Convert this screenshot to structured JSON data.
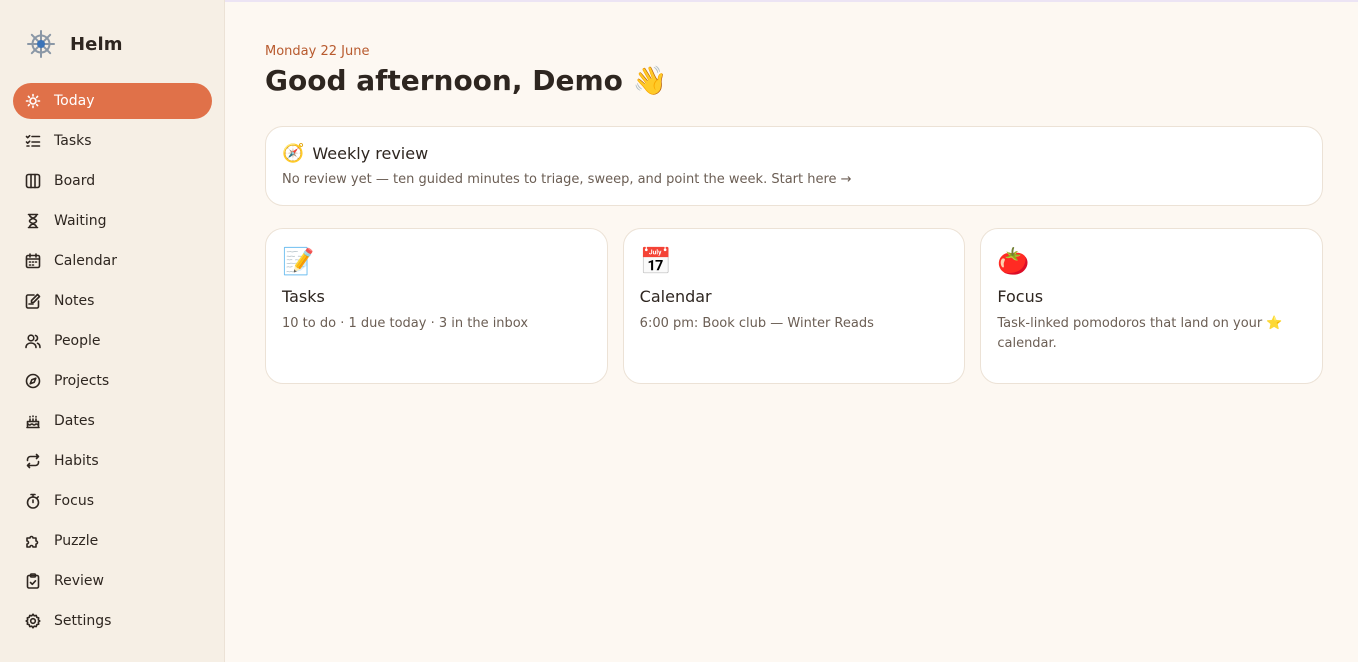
{
  "app": {
    "name": "Helm"
  },
  "sidebar": {
    "items": [
      {
        "label": "Today",
        "icon": "sun-icon",
        "active": true
      },
      {
        "label": "Tasks",
        "icon": "checklist-icon"
      },
      {
        "label": "Board",
        "icon": "columns-icon"
      },
      {
        "label": "Waiting",
        "icon": "hourglass-icon"
      },
      {
        "label": "Calendar",
        "icon": "calendar-icon"
      },
      {
        "label": "Notes",
        "icon": "note-edit-icon"
      },
      {
        "label": "People",
        "icon": "people-icon"
      },
      {
        "label": "Projects",
        "icon": "compass-icon"
      },
      {
        "label": "Dates",
        "icon": "cake-icon"
      },
      {
        "label": "Habits",
        "icon": "repeat-icon"
      },
      {
        "label": "Focus",
        "icon": "stopwatch-icon"
      },
      {
        "label": "Puzzle",
        "icon": "puzzle-icon"
      },
      {
        "label": "Review",
        "icon": "clipboard-check-icon"
      },
      {
        "label": "Settings",
        "icon": "gear-icon"
      }
    ]
  },
  "main": {
    "date": "Monday 22 June",
    "greeting": "Good afternoon, Demo 👋",
    "review": {
      "emoji": "🧭",
      "title": "Weekly review",
      "text": "No review yet — ten guided minutes to triage, sweep, and point the week. Start here →"
    },
    "cards": [
      {
        "emoji": "📝",
        "title": "Tasks",
        "text": "10 to do · 1 due today · 3 in the inbox"
      },
      {
        "emoji": "📅",
        "title": "Calendar",
        "text": "6:00 pm: Book club — Winter Reads"
      },
      {
        "emoji": "🍅",
        "title": "Focus",
        "text": "Task-linked pomodoros that land on your ⭐ calendar."
      }
    ]
  },
  "colors": {
    "accent": "#e07149",
    "background": "#fdf8f2",
    "sidebar": "#f6efe5",
    "date_text": "#b85a2e"
  }
}
